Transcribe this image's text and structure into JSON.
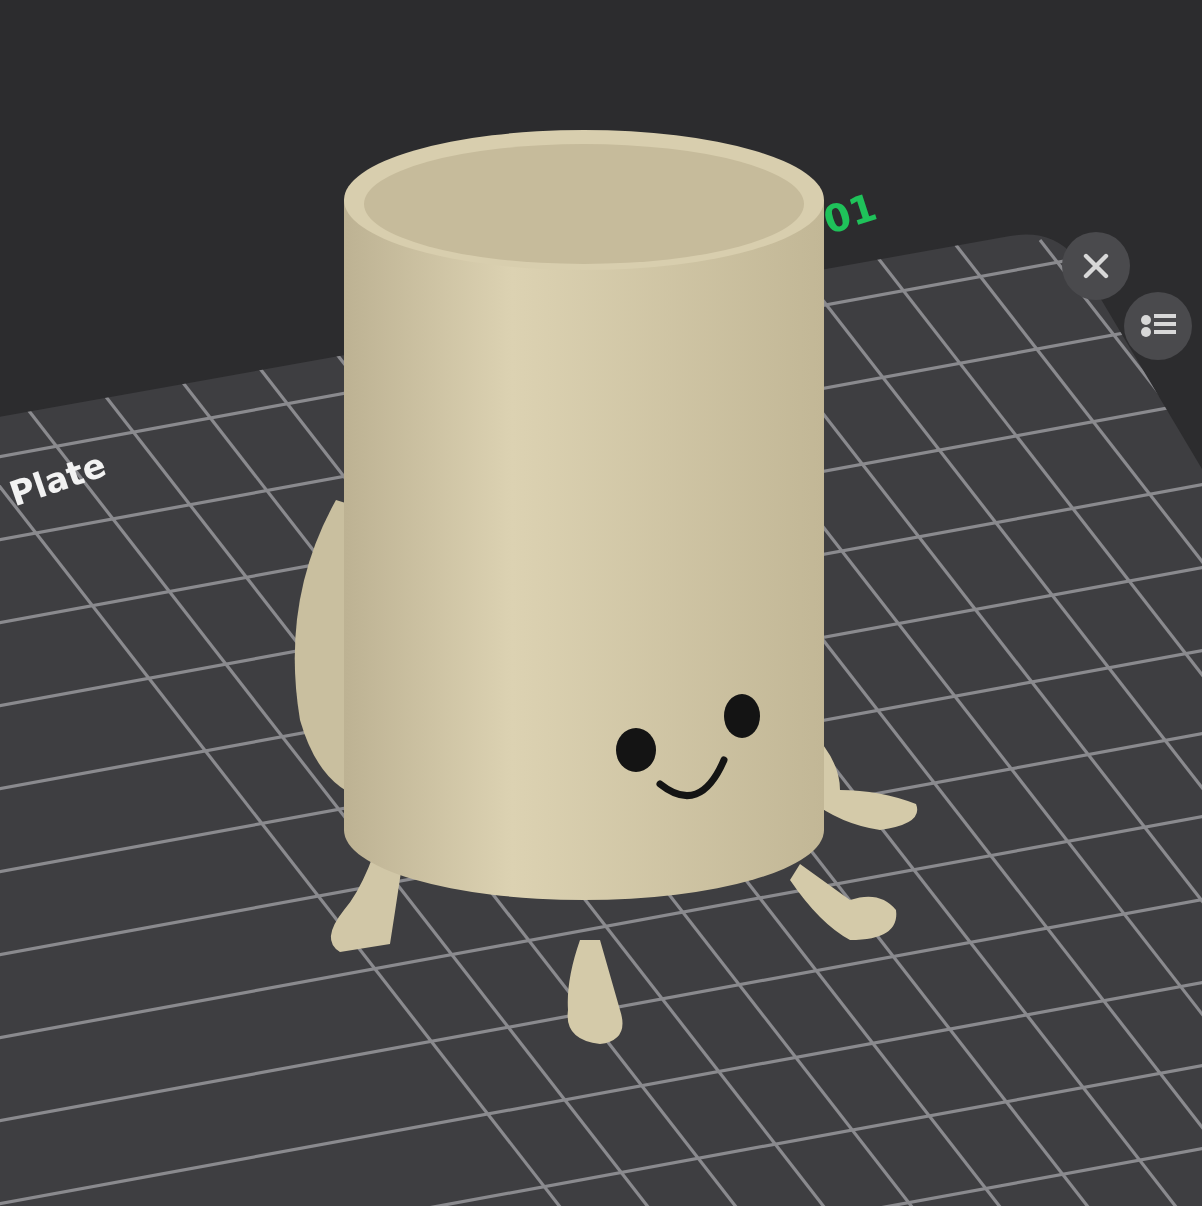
{
  "plate": {
    "label": "Plate",
    "number": "01"
  },
  "buttons": [
    {
      "kind": "close"
    },
    {
      "kind": "list"
    }
  ]
}
